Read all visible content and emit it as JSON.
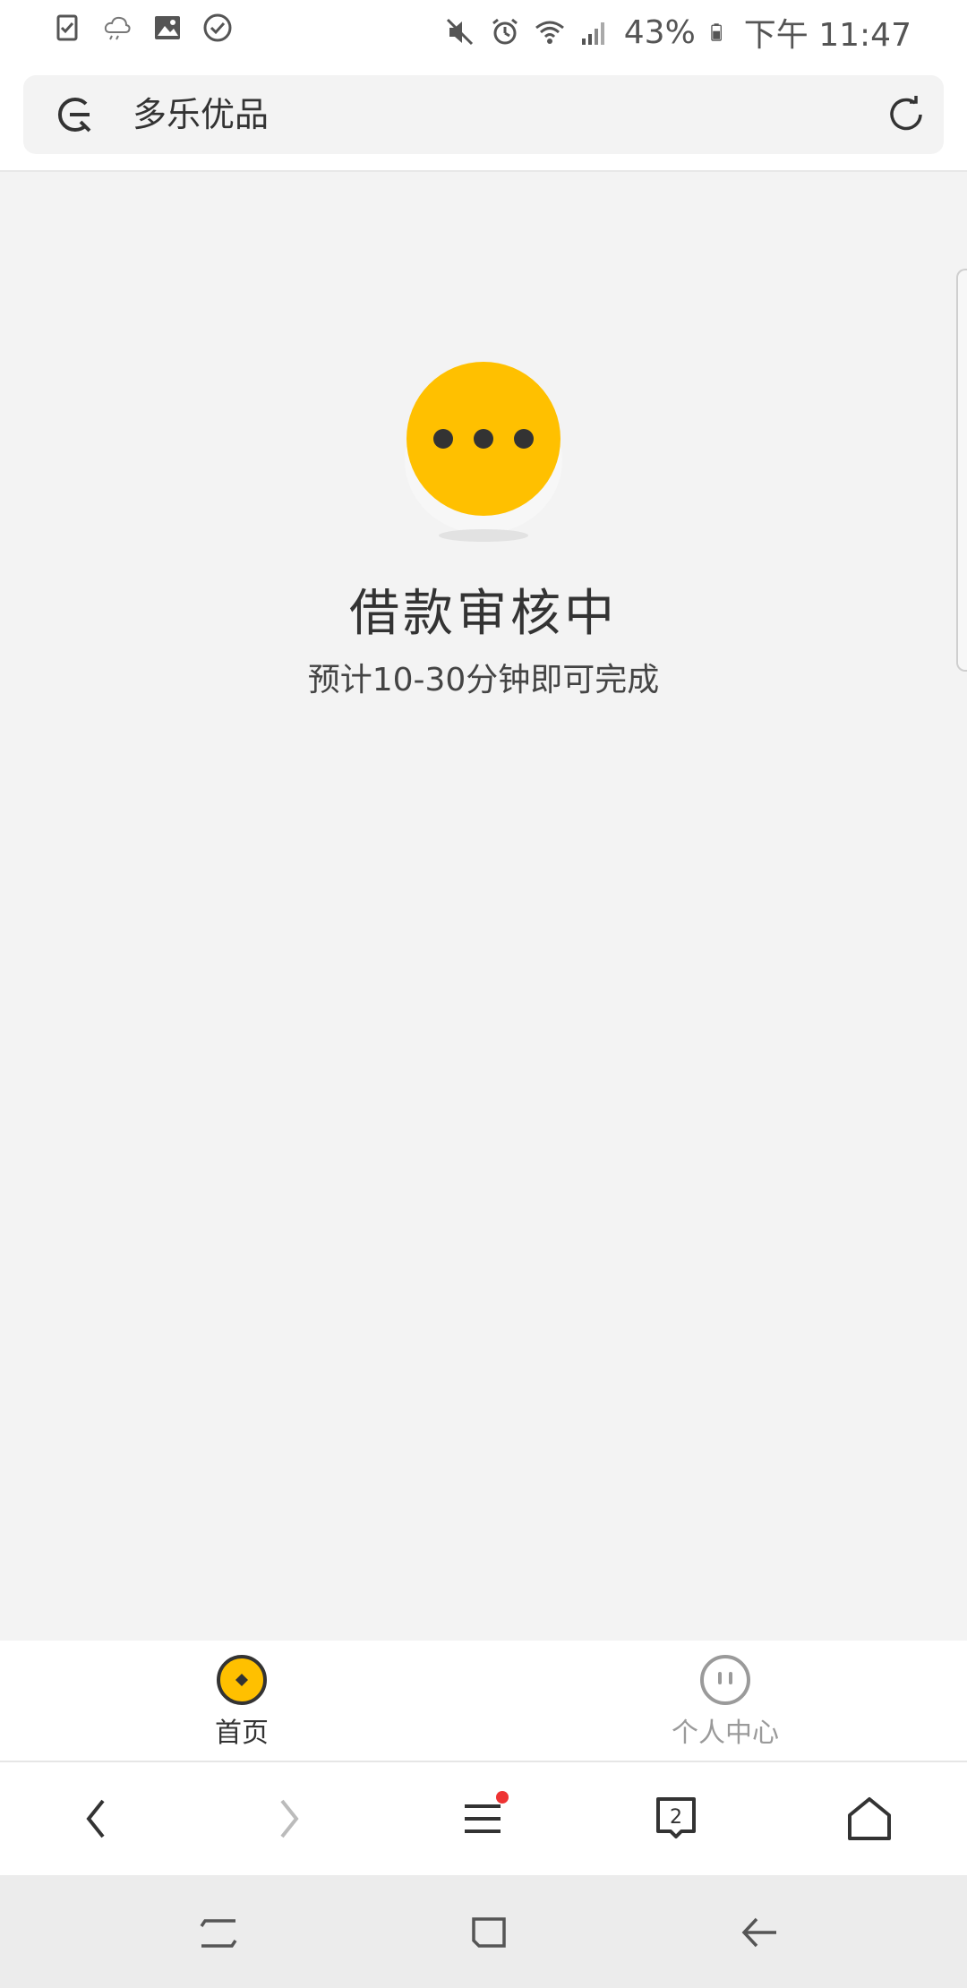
{
  "status_bar": {
    "battery": "43%",
    "time": "下午 11:47"
  },
  "address_bar": {
    "title": "多乐优品"
  },
  "loan_status": {
    "title": "借款审核中",
    "subtitle": "预计10-30分钟即可完成"
  },
  "tabs": [
    {
      "label": "首页",
      "active": true
    },
    {
      "label": "个人中心",
      "active": false
    }
  ],
  "browser_toolbar": {
    "tab_count": "2"
  },
  "colors": {
    "accent_yellow": "#ffc000",
    "badge_red": "#ee3333",
    "background": "#f3f3f3"
  }
}
